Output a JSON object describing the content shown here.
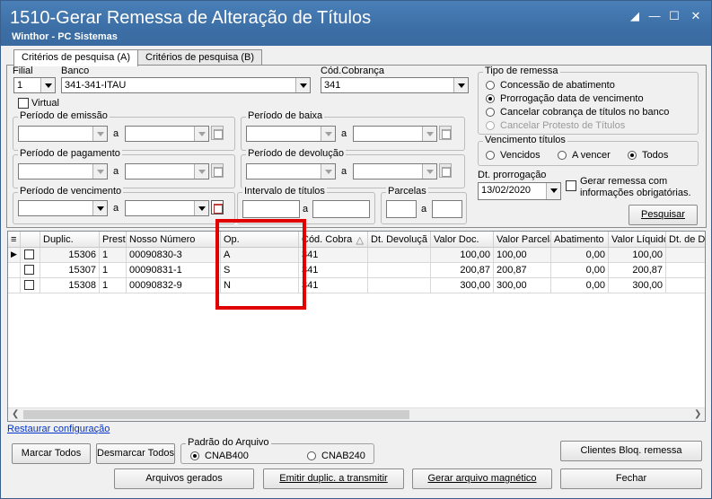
{
  "window": {
    "title": "1510-Gerar Remessa de Alteração de Títulos",
    "subtitle": "Winthor - PC Sistemas",
    "controls": [
      "restore-icon",
      "minimize-icon",
      "maximize-icon",
      "close-icon"
    ]
  },
  "tabs": [
    {
      "label": "Critérios de pesquisa (A)",
      "active": true
    },
    {
      "label": "Critérios de pesquisa (B)",
      "active": false
    }
  ],
  "filters": {
    "filial_label": "Filial",
    "filial_value": "1",
    "banco_label": "Banco",
    "banco_value": "341-341-ITAU",
    "cod_cobranca_label": "Cód.Cobrança",
    "cod_cobranca_value": "341",
    "virtual_label": "Virtual"
  },
  "periods": {
    "a_label": "a",
    "emissao": "Período de emissão",
    "baixa": "Período de baixa",
    "pagamento": "Período de pagamento",
    "devolucao": "Período de devolução",
    "vencimento": "Período de vencimento",
    "intervalo": "Intervalo de títulos",
    "parcelas": "Parcelas"
  },
  "tipo_remessa": {
    "title": "Tipo de remessa",
    "options": [
      {
        "label": "Concessão de abatimento",
        "selected": false,
        "disabled": false
      },
      {
        "label": "Prorrogação data de vencimento",
        "selected": true,
        "disabled": false
      },
      {
        "label": "Cancelar cobrança de títulos no banco",
        "selected": false,
        "disabled": false
      },
      {
        "label": "Cancelar Protesto de Títulos",
        "selected": false,
        "disabled": true
      }
    ]
  },
  "vencimento_titulos": {
    "title": "Vencimento títulos",
    "options": [
      {
        "label": "Vencidos",
        "selected": false
      },
      {
        "label": "A vencer",
        "selected": false
      },
      {
        "label": "Todos",
        "selected": true
      }
    ]
  },
  "prorrogacao": {
    "label": "Dt. prorrogação",
    "value": "13/02/2020",
    "gerar_label_1": "Gerar remessa com",
    "gerar_label_2": "informações obrigatórias."
  },
  "buttons": {
    "pesquisar": "Pesquisar",
    "marcar_todos": "Marcar Todos",
    "desmarcar_todos": "Desmarcar Todos",
    "clientes_bloq": "Clientes Bloq. remessa",
    "arquivos_gerados": "Arquivos gerados",
    "emitir_duplic": "Emitir duplic. a transmitir",
    "gerar_arquivo": "Gerar arquivo magnético",
    "fechar": "Fechar"
  },
  "grid": {
    "columns": [
      "Duplic.",
      "Prest",
      "Nosso Número",
      "Op.",
      "Cód. Cobra",
      "Dt. Devoluçã",
      "Valor Doc.",
      "Valor Parcela",
      "Abatimento",
      "Valor Líquido",
      "Dt. de D"
    ],
    "rows": [
      {
        "duplic": "15306",
        "prest": "1",
        "nosso_numero": "00090830-3",
        "op": "A",
        "cod_cobra": "341",
        "dt_devolucao": "",
        "valor_doc": "100,00",
        "valor_parcela": "100,00",
        "abatimento": "0,00",
        "valor_liquido": "100,00",
        "dt_de": ""
      },
      {
        "duplic": "15307",
        "prest": "1",
        "nosso_numero": "00090831-1",
        "op": "S",
        "cod_cobra": "341",
        "dt_devolucao": "",
        "valor_doc": "200,87",
        "valor_parcela": "200,87",
        "abatimento": "0,00",
        "valor_liquido": "200,87",
        "dt_de": ""
      },
      {
        "duplic": "15308",
        "prest": "1",
        "nosso_numero": "00090832-9",
        "op": "N",
        "cod_cobra": "341",
        "dt_devolucao": "",
        "valor_doc": "300,00",
        "valor_parcela": "300,00",
        "abatimento": "0,00",
        "valor_liquido": "300,00",
        "dt_de": ""
      }
    ]
  },
  "restaurar_link": "Restaurar configuração",
  "padrao_arquivo": {
    "title": "Padrão do Arquivo",
    "options": [
      {
        "label": "CNAB400",
        "selected": true
      },
      {
        "label": "CNAB240",
        "selected": false
      }
    ]
  },
  "colors": {
    "titlebar": "#3c6fa6",
    "highlight": "#e00000",
    "link": "#0033cc"
  }
}
